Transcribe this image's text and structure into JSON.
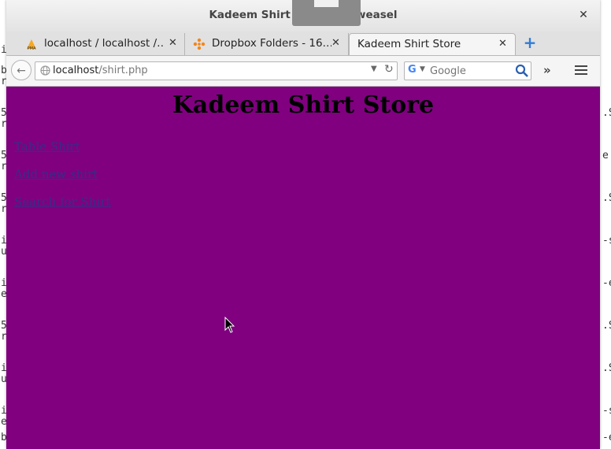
{
  "window": {
    "title": "Kadeem Shirt Store - Iceweasel",
    "close_glyph": "✕"
  },
  "tabs": [
    {
      "label": "localhost / localhost /…",
      "icon": "phpmyadmin-icon",
      "active": false
    },
    {
      "label": "Dropbox Folders - 16…",
      "icon": "dropbox-icon",
      "active": false
    },
    {
      "label": "Kadeem Shirt Store",
      "icon": "",
      "active": true
    }
  ],
  "new_tab_glyph": "+",
  "tab_close_glyph": "✕",
  "address": {
    "host": "localhost",
    "path": "/shirt.php"
  },
  "search": {
    "engine": "G",
    "placeholder": "Google"
  },
  "overflow_glyph": "»",
  "page": {
    "heading": "Kadeem Shirt Store",
    "background": "#800080",
    "links": [
      "Table Shirt",
      "Add new shirt",
      "Search for Shirt"
    ]
  },
  "background_terminal": {
    "left_chars": [
      "it",
      "b",
      "r",
      "5",
      "r",
      "5",
      "r",
      "5",
      "r",
      "i",
      "u",
      "i",
      "e",
      "5",
      "r",
      "i",
      "u",
      "i",
      "e",
      "b"
    ],
    "right_chars": [
      ".S",
      "e",
      ".S",
      ".S",
      "-s",
      "-e",
      ".S",
      "-s",
      "-e"
    ]
  }
}
